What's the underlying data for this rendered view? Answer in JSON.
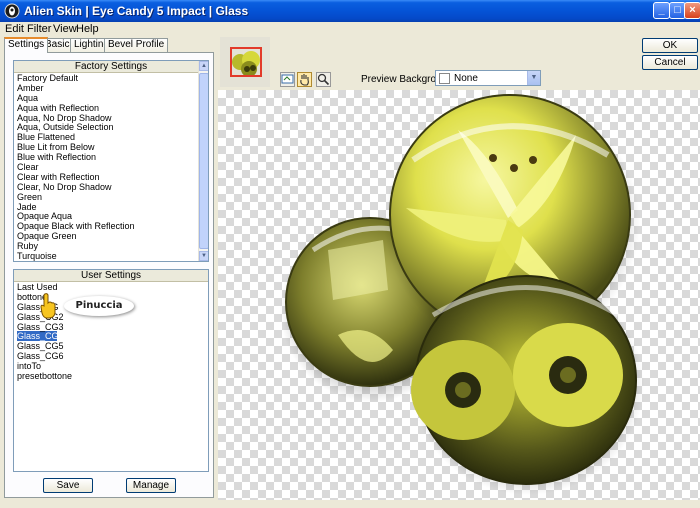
{
  "window": {
    "title": "Alien Skin | Eye Candy 5 Impact | Glass",
    "controls": {
      "minimize": "_",
      "maximize": "□",
      "close": "×"
    }
  },
  "menu": [
    "Edit",
    "Filter",
    "View",
    "Help"
  ],
  "tabs": [
    {
      "label": "Settings",
      "active": true
    },
    {
      "label": "Basic",
      "active": false
    },
    {
      "label": "Lighting",
      "active": false
    },
    {
      "label": "Bevel Profile",
      "active": false
    }
  ],
  "factory_settings": {
    "header": "Factory Settings",
    "items": [
      "Factory Default",
      "Amber",
      "Aqua",
      "Aqua with Reflection",
      "Aqua, No Drop Shadow",
      "Aqua, Outside Selection",
      "Blue Flattened",
      "Blue Lit from Below",
      "Blue with Reflection",
      "Clear",
      "Clear with Reflection",
      "Clear, No Drop Shadow",
      "Green",
      "Jade",
      "Opaque Aqua",
      "Opaque Black with Reflection",
      "Opaque Green",
      "Ruby",
      "Turquoise"
    ]
  },
  "user_settings": {
    "header": "User Settings",
    "items": [
      "Last Used",
      "bottone",
      "Glass_CG",
      "Glass_CG2",
      "Glass_CG3",
      "Glass_CG4",
      "Glass_CG5",
      "Glass_CG6",
      "intoTo",
      "presetbottone"
    ],
    "selected_index": 5
  },
  "buttons": {
    "save": "Save",
    "manage": "Manage",
    "ok": "OK",
    "cancel": "Cancel"
  },
  "toolbar": {
    "preview_background_label": "Preview Background:",
    "preview_background_value": "None"
  },
  "watermark": "Pinuccia",
  "icons": {
    "app": "alien-skin-icon",
    "zoom_fit": "navigate-icon",
    "hand": "hand-tool-icon",
    "zoom": "magnifier-icon",
    "cursor": "hand-pointer-icon"
  },
  "colors": {
    "titlebar": "#0553d6",
    "selection": "#316ac5",
    "tab_highlight": "#e68b2c",
    "flower_yellow": "#e6e84a",
    "foliage_dark": "#2a2e10"
  }
}
